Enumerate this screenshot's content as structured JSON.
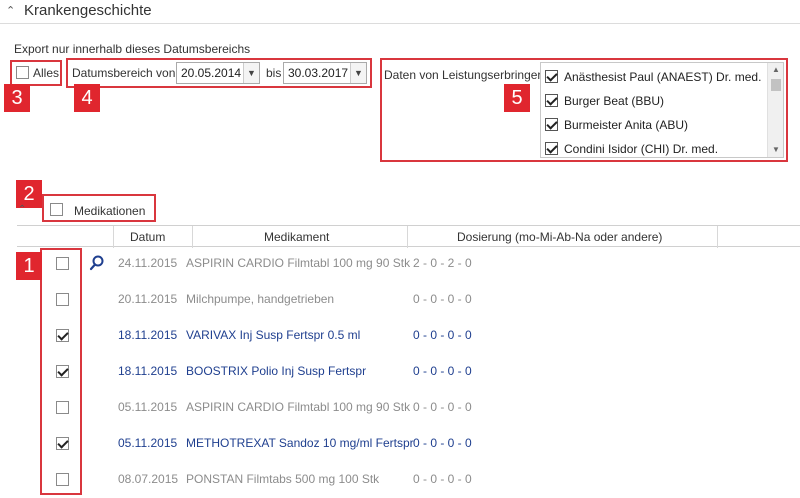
{
  "section": {
    "title": "Krankengeschichte",
    "collapse_icon": "chevron-up-icon"
  },
  "export": {
    "label": "Export nur innerhalb dieses Datumsbereichs",
    "all_label": "Alles",
    "all_checked": false,
    "date_range_label": "Datumsbereich von",
    "from_value": "20.05.2014",
    "to_label": "bis",
    "to_value": "30.03.2017"
  },
  "providers": {
    "label": "Daten von Leistungserbringer",
    "items": [
      {
        "label": "Anästhesist Paul (ANAEST) Dr. med.",
        "checked": true
      },
      {
        "label": "Burger Beat (BBU)",
        "checked": true
      },
      {
        "label": "Burmeister Anita (ABU)",
        "checked": true
      },
      {
        "label": "Condini Isidor (CHI) Dr. med.",
        "checked": true
      }
    ]
  },
  "medications": {
    "label": "Medikationen",
    "checked": false,
    "columns": [
      "Datum",
      "Medikament",
      "Dosierung (mo-Mi-Ab-Na oder andere)"
    ],
    "rows": [
      {
        "checked": false,
        "date": "24.11.2015",
        "name": "ASPIRIN CARDIO Filmtabl 100 mg 90 Stk",
        "dose": "2 - 0 - 2 - 0",
        "style": "grey",
        "search": true
      },
      {
        "checked": false,
        "date": "20.11.2015",
        "name": "Milchpumpe, handgetrieben",
        "dose": "0 - 0 - 0 - 0",
        "style": "grey",
        "search": false
      },
      {
        "checked": true,
        "date": "18.11.2015",
        "name": "VARIVAX Inj Susp Fertspr 0.5 ml",
        "dose": "0 - 0 - 0 - 0",
        "style": "blue",
        "search": false
      },
      {
        "checked": true,
        "date": "18.11.2015",
        "name": "BOOSTRIX Polio Inj Susp Fertspr",
        "dose": "0 - 0 - 0 - 0",
        "style": "blue",
        "search": false
      },
      {
        "checked": false,
        "date": "05.11.2015",
        "name": "ASPIRIN CARDIO Filmtabl 100 mg 90 Stk",
        "dose": "0 - 0 - 0 - 0",
        "style": "grey",
        "search": false
      },
      {
        "checked": true,
        "date": "05.11.2015",
        "name": "METHOTREXAT Sandoz 10 mg/ml Fertspr",
        "dose": "0 - 0 - 0 - 0",
        "style": "blue",
        "search": false
      },
      {
        "checked": false,
        "date": "08.07.2015",
        "name": "PONSTAN Filmtabs 500 mg 100 Stk",
        "dose": "0 - 0 - 0 - 0",
        "style": "grey",
        "search": false
      }
    ]
  },
  "annotations": [
    "1",
    "2",
    "3",
    "4",
    "5"
  ],
  "colors": {
    "highlight": "#d9363e",
    "checked_text": "#1f3f8f",
    "unchecked_text": "#8c8c8c"
  }
}
